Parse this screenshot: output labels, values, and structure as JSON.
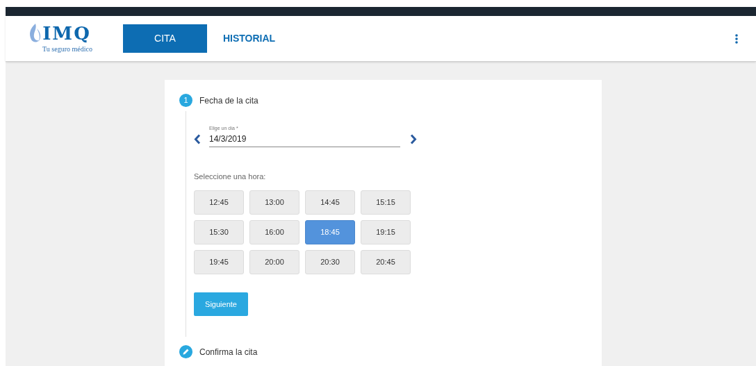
{
  "header": {
    "logo": {
      "name": "IMQ",
      "tagline": "Tu seguro médico"
    },
    "tabs": [
      {
        "label": "CITA",
        "selected": true
      },
      {
        "label": "HISTORIAL",
        "selected": false
      }
    ]
  },
  "steps": [
    {
      "kind": "number",
      "badge": "1",
      "title": "Fecha de la cita",
      "expanded": true,
      "date_field": {
        "label": "Elige un día *",
        "value": "14/3/2019"
      },
      "time_prompt": "Seleccione una hora:",
      "times": [
        {
          "label": "12:45",
          "selected": false
        },
        {
          "label": "13:00",
          "selected": false
        },
        {
          "label": "14:45",
          "selected": false
        },
        {
          "label": "15:15",
          "selected": false
        },
        {
          "label": "15:30",
          "selected": false
        },
        {
          "label": "16:00",
          "selected": false
        },
        {
          "label": "18:45",
          "selected": true
        },
        {
          "label": "19:15",
          "selected": false
        },
        {
          "label": "19:45",
          "selected": false
        },
        {
          "label": "20:00",
          "selected": false
        },
        {
          "label": "20:30",
          "selected": false
        },
        {
          "label": "20:45",
          "selected": false
        }
      ],
      "next_button": "Siguiente"
    },
    {
      "kind": "edit",
      "title": "Confirma la cita",
      "expanded": false
    }
  ]
}
